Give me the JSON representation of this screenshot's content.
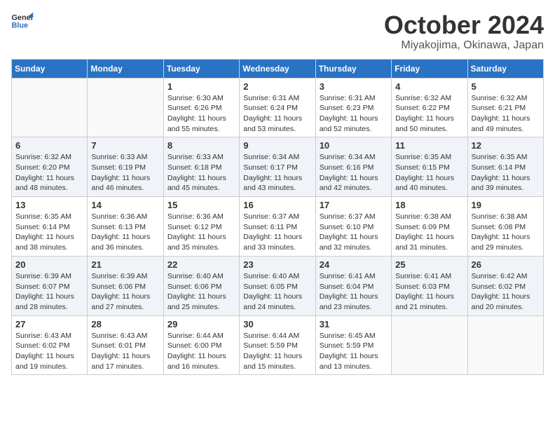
{
  "logo": {
    "line1": "General",
    "line2": "Blue"
  },
  "title": "October 2024",
  "location": "Miyakojima, Okinawa, Japan",
  "weekdays": [
    "Sunday",
    "Monday",
    "Tuesday",
    "Wednesday",
    "Thursday",
    "Friday",
    "Saturday"
  ],
  "weeks": [
    [
      {
        "day": "",
        "sunrise": "",
        "sunset": "",
        "daylight": ""
      },
      {
        "day": "",
        "sunrise": "",
        "sunset": "",
        "daylight": ""
      },
      {
        "day": "1",
        "sunrise": "Sunrise: 6:30 AM",
        "sunset": "Sunset: 6:26 PM",
        "daylight": "Daylight: 11 hours and 55 minutes."
      },
      {
        "day": "2",
        "sunrise": "Sunrise: 6:31 AM",
        "sunset": "Sunset: 6:24 PM",
        "daylight": "Daylight: 11 hours and 53 minutes."
      },
      {
        "day": "3",
        "sunrise": "Sunrise: 6:31 AM",
        "sunset": "Sunset: 6:23 PM",
        "daylight": "Daylight: 11 hours and 52 minutes."
      },
      {
        "day": "4",
        "sunrise": "Sunrise: 6:32 AM",
        "sunset": "Sunset: 6:22 PM",
        "daylight": "Daylight: 11 hours and 50 minutes."
      },
      {
        "day": "5",
        "sunrise": "Sunrise: 6:32 AM",
        "sunset": "Sunset: 6:21 PM",
        "daylight": "Daylight: 11 hours and 49 minutes."
      }
    ],
    [
      {
        "day": "6",
        "sunrise": "Sunrise: 6:32 AM",
        "sunset": "Sunset: 6:20 PM",
        "daylight": "Daylight: 11 hours and 48 minutes."
      },
      {
        "day": "7",
        "sunrise": "Sunrise: 6:33 AM",
        "sunset": "Sunset: 6:19 PM",
        "daylight": "Daylight: 11 hours and 46 minutes."
      },
      {
        "day": "8",
        "sunrise": "Sunrise: 6:33 AM",
        "sunset": "Sunset: 6:18 PM",
        "daylight": "Daylight: 11 hours and 45 minutes."
      },
      {
        "day": "9",
        "sunrise": "Sunrise: 6:34 AM",
        "sunset": "Sunset: 6:17 PM",
        "daylight": "Daylight: 11 hours and 43 minutes."
      },
      {
        "day": "10",
        "sunrise": "Sunrise: 6:34 AM",
        "sunset": "Sunset: 6:16 PM",
        "daylight": "Daylight: 11 hours and 42 minutes."
      },
      {
        "day": "11",
        "sunrise": "Sunrise: 6:35 AM",
        "sunset": "Sunset: 6:15 PM",
        "daylight": "Daylight: 11 hours and 40 minutes."
      },
      {
        "day": "12",
        "sunrise": "Sunrise: 6:35 AM",
        "sunset": "Sunset: 6:14 PM",
        "daylight": "Daylight: 11 hours and 39 minutes."
      }
    ],
    [
      {
        "day": "13",
        "sunrise": "Sunrise: 6:35 AM",
        "sunset": "Sunset: 6:14 PM",
        "daylight": "Daylight: 11 hours and 38 minutes."
      },
      {
        "day": "14",
        "sunrise": "Sunrise: 6:36 AM",
        "sunset": "Sunset: 6:13 PM",
        "daylight": "Daylight: 11 hours and 36 minutes."
      },
      {
        "day": "15",
        "sunrise": "Sunrise: 6:36 AM",
        "sunset": "Sunset: 6:12 PM",
        "daylight": "Daylight: 11 hours and 35 minutes."
      },
      {
        "day": "16",
        "sunrise": "Sunrise: 6:37 AM",
        "sunset": "Sunset: 6:11 PM",
        "daylight": "Daylight: 11 hours and 33 minutes."
      },
      {
        "day": "17",
        "sunrise": "Sunrise: 6:37 AM",
        "sunset": "Sunset: 6:10 PM",
        "daylight": "Daylight: 11 hours and 32 minutes."
      },
      {
        "day": "18",
        "sunrise": "Sunrise: 6:38 AM",
        "sunset": "Sunset: 6:09 PM",
        "daylight": "Daylight: 11 hours and 31 minutes."
      },
      {
        "day": "19",
        "sunrise": "Sunrise: 6:38 AM",
        "sunset": "Sunset: 6:08 PM",
        "daylight": "Daylight: 11 hours and 29 minutes."
      }
    ],
    [
      {
        "day": "20",
        "sunrise": "Sunrise: 6:39 AM",
        "sunset": "Sunset: 6:07 PM",
        "daylight": "Daylight: 11 hours and 28 minutes."
      },
      {
        "day": "21",
        "sunrise": "Sunrise: 6:39 AM",
        "sunset": "Sunset: 6:06 PM",
        "daylight": "Daylight: 11 hours and 27 minutes."
      },
      {
        "day": "22",
        "sunrise": "Sunrise: 6:40 AM",
        "sunset": "Sunset: 6:06 PM",
        "daylight": "Daylight: 11 hours and 25 minutes."
      },
      {
        "day": "23",
        "sunrise": "Sunrise: 6:40 AM",
        "sunset": "Sunset: 6:05 PM",
        "daylight": "Daylight: 11 hours and 24 minutes."
      },
      {
        "day": "24",
        "sunrise": "Sunrise: 6:41 AM",
        "sunset": "Sunset: 6:04 PM",
        "daylight": "Daylight: 11 hours and 23 minutes."
      },
      {
        "day": "25",
        "sunrise": "Sunrise: 6:41 AM",
        "sunset": "Sunset: 6:03 PM",
        "daylight": "Daylight: 11 hours and 21 minutes."
      },
      {
        "day": "26",
        "sunrise": "Sunrise: 6:42 AM",
        "sunset": "Sunset: 6:02 PM",
        "daylight": "Daylight: 11 hours and 20 minutes."
      }
    ],
    [
      {
        "day": "27",
        "sunrise": "Sunrise: 6:43 AM",
        "sunset": "Sunset: 6:02 PM",
        "daylight": "Daylight: 11 hours and 19 minutes."
      },
      {
        "day": "28",
        "sunrise": "Sunrise: 6:43 AM",
        "sunset": "Sunset: 6:01 PM",
        "daylight": "Daylight: 11 hours and 17 minutes."
      },
      {
        "day": "29",
        "sunrise": "Sunrise: 6:44 AM",
        "sunset": "Sunset: 6:00 PM",
        "daylight": "Daylight: 11 hours and 16 minutes."
      },
      {
        "day": "30",
        "sunrise": "Sunrise: 6:44 AM",
        "sunset": "Sunset: 5:59 PM",
        "daylight": "Daylight: 11 hours and 15 minutes."
      },
      {
        "day": "31",
        "sunrise": "Sunrise: 6:45 AM",
        "sunset": "Sunset: 5:59 PM",
        "daylight": "Daylight: 11 hours and 13 minutes."
      },
      {
        "day": "",
        "sunrise": "",
        "sunset": "",
        "daylight": ""
      },
      {
        "day": "",
        "sunrise": "",
        "sunset": "",
        "daylight": ""
      }
    ]
  ]
}
